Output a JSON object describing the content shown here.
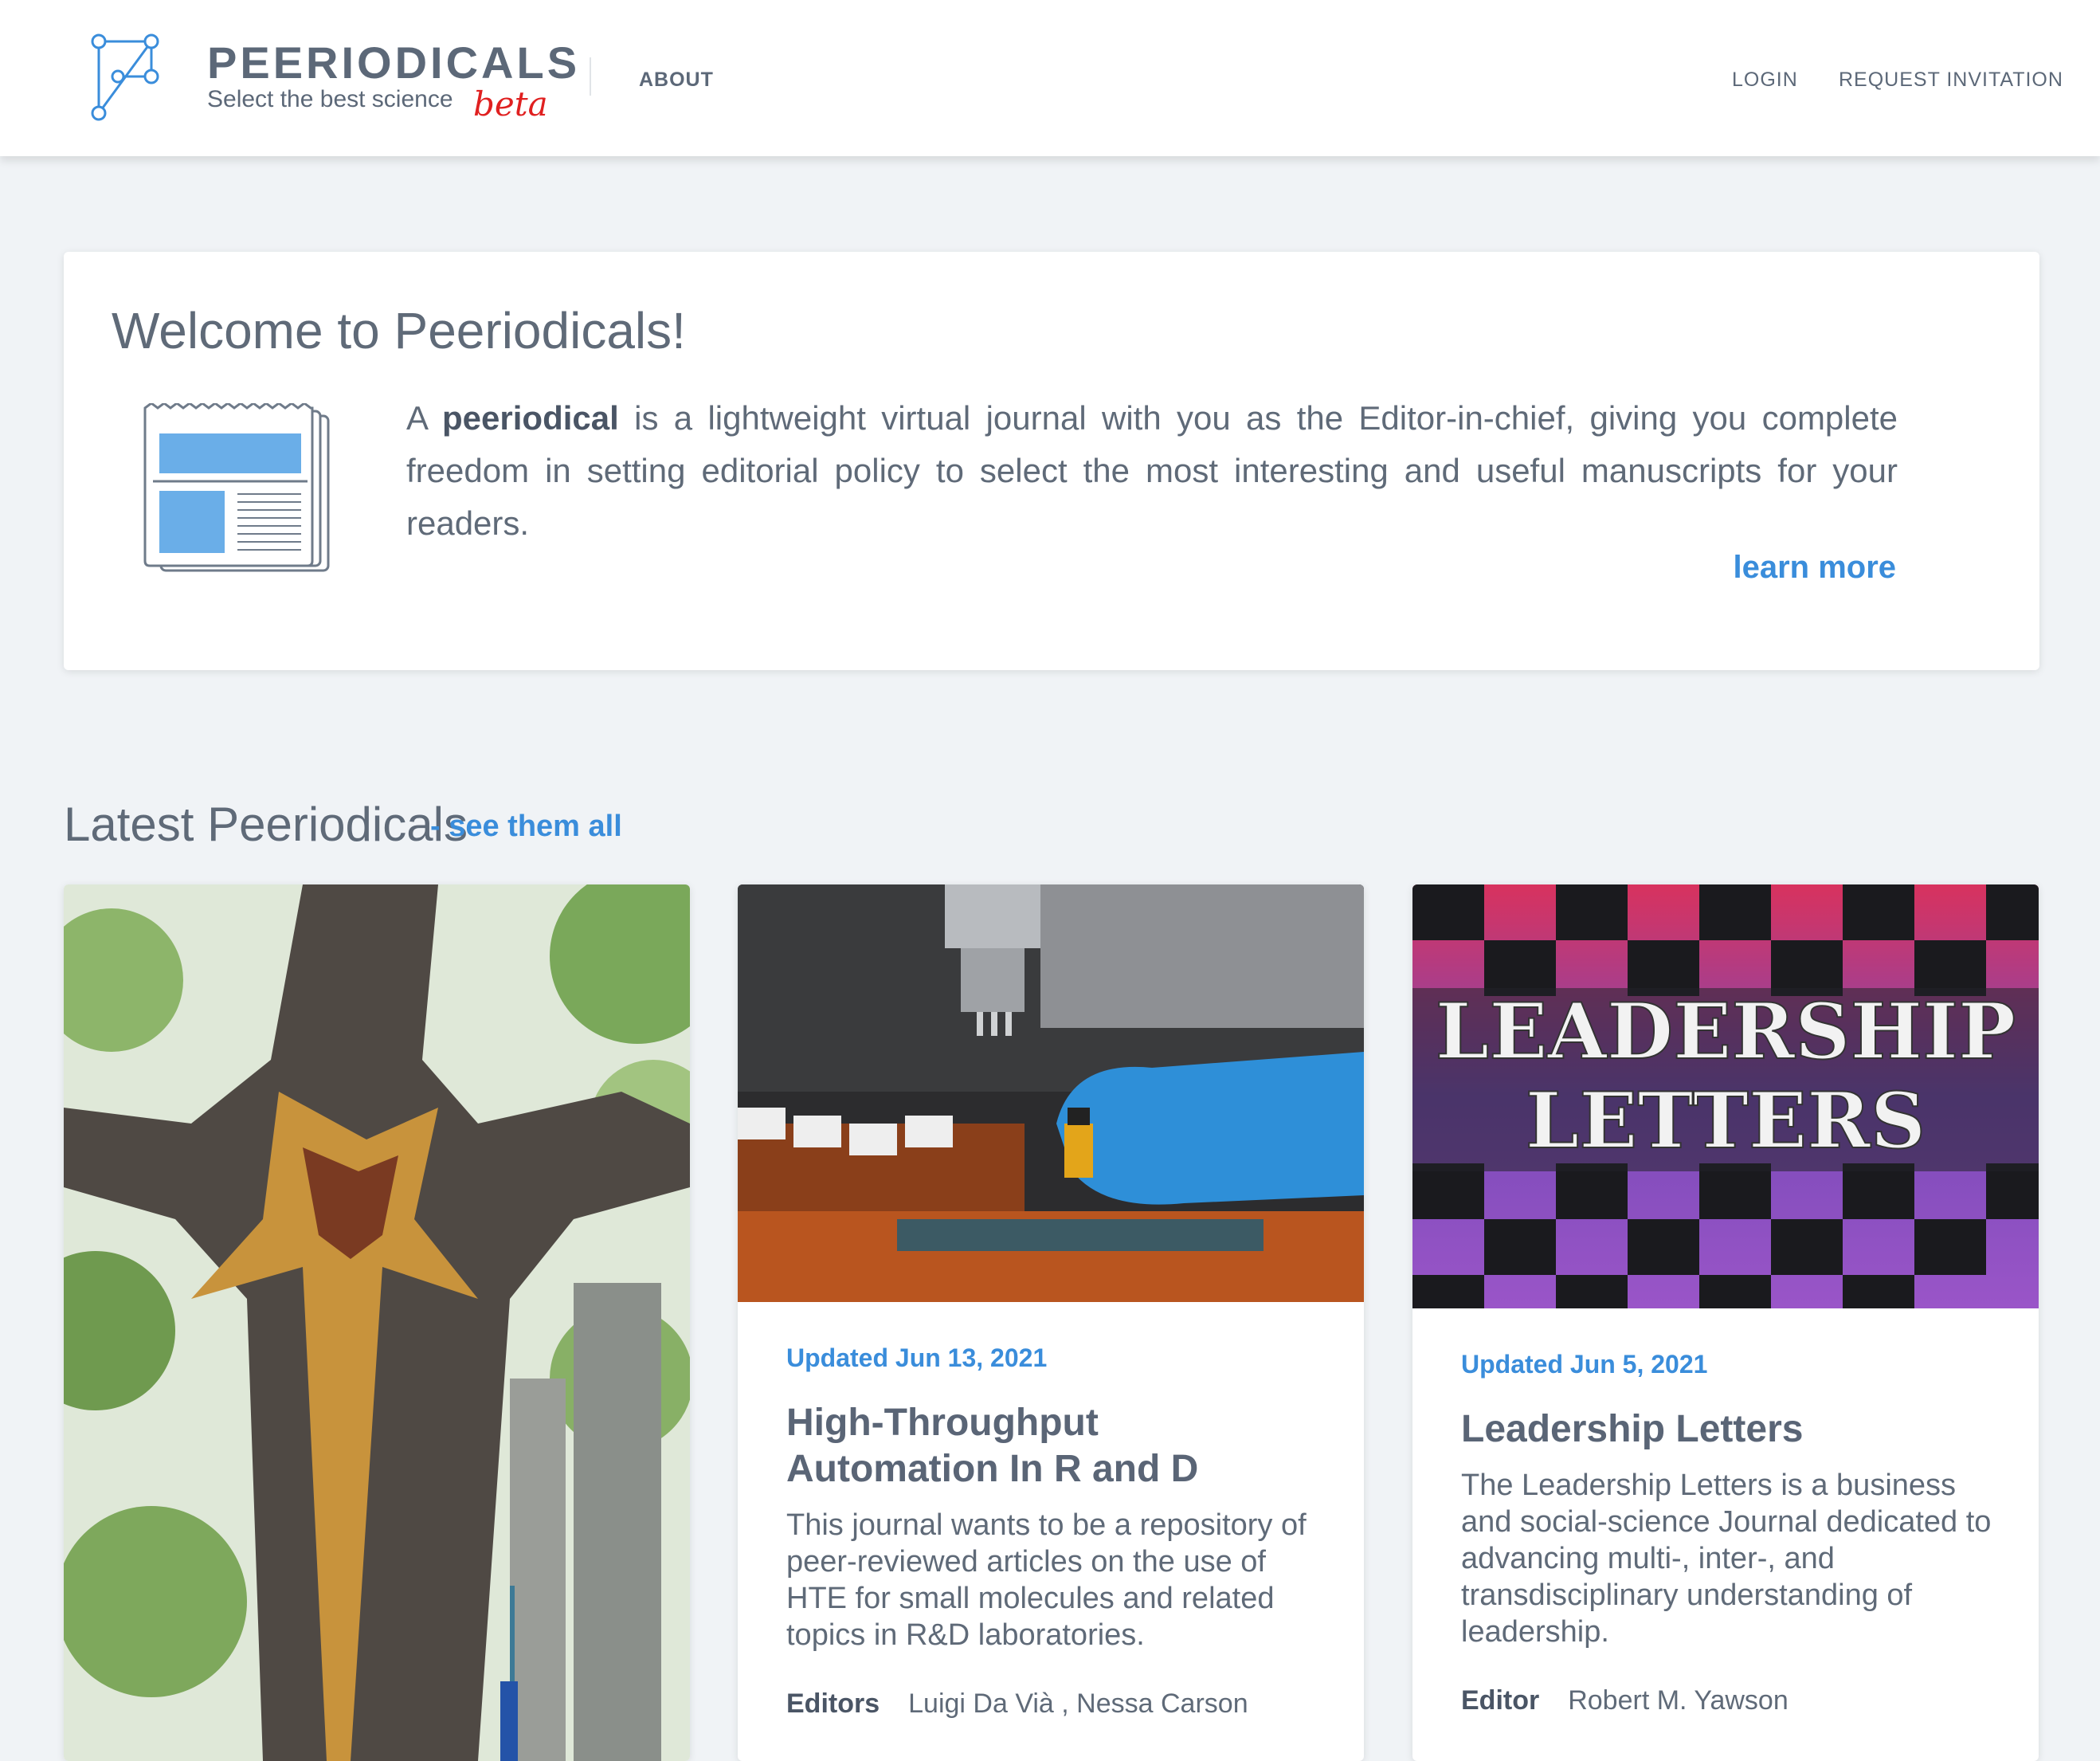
{
  "header": {
    "brand_name": "PEERIODICALS",
    "brand_tagline": "Select the best science",
    "brand_badge": "beta",
    "nav": {
      "about": "ABOUT",
      "login": "LOGIN",
      "request_invitation": "REQUEST INVITATION"
    }
  },
  "welcome": {
    "title": "Welcome to Peeriodicals!",
    "text_prefix": "A",
    "text_bold": "peeriodical",
    "text_rest": "is a lightweight virtual journal with you as the Editor-in-chief, giving you complete freedom in setting editorial policy to select the most interesting and useful manuscripts for your readers.",
    "learn_more": "learn more"
  },
  "latest": {
    "heading": "Latest Peeriodicals",
    "see_all": "- see them all"
  },
  "cards": [
    {
      "image": "split-tree-trunk-photo"
    },
    {
      "image": "lab-automation-photo",
      "updated": "Updated Jun 13, 2021",
      "title": "High-Throughput Automation In R and D",
      "description": "This journal wants to be a repository of peer-reviewed articles on the use of HTE for small molecules and related topics in R&D laboratories.",
      "editors_label": "Editors",
      "editors": "Luigi Da Vià , Nessa Carson"
    },
    {
      "image": "leadership-letters-puzzle-banner",
      "image_text_line1": "LEADERSHIP",
      "image_text_line2": "LETTERS",
      "updated": "Updated Jun 5, 2021",
      "title": "Leadership Letters",
      "description": "The Leadership Letters is a business and social-science Journal dedicated to advancing multi-, inter-, and transdisciplinary understanding of leadership.",
      "editors_label": "Editor",
      "editors": "Robert M. Yawson"
    }
  ],
  "colors": {
    "accent": "#3a8ddb",
    "beta": "#e02020",
    "background": "#f0f3f6",
    "text": "#5f6a78"
  },
  "icons": {
    "logo": "network-graph-logo-icon",
    "newspaper": "newspaper-icon"
  }
}
